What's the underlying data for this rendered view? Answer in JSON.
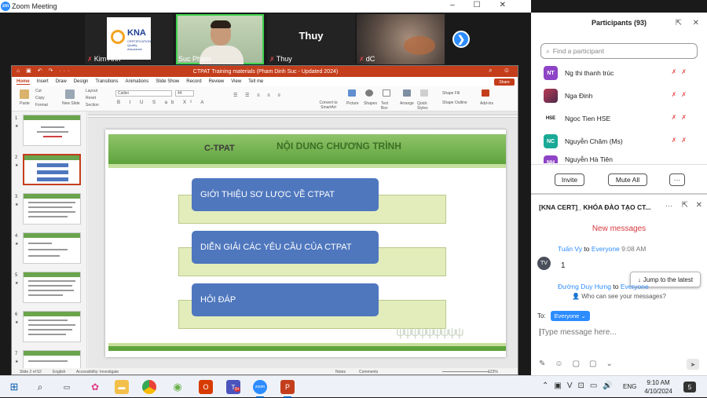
{
  "zoom": {
    "title": "Zoom Meeting",
    "logo_text": "zm",
    "tiles": [
      {
        "name": "Kim Anh",
        "logo": "KNA",
        "logo_sub": "CERTIFICATION Quality Assurance"
      },
      {
        "name": "Suc Pham"
      },
      {
        "name": "Thuy",
        "center": "Thuy"
      },
      {
        "name": "dC"
      }
    ]
  },
  "ppt": {
    "title": "CTPAT Training materials (Pham Dinh Suc - Updated 2024)",
    "tabs": [
      "Home",
      "Insert",
      "Draw",
      "Design",
      "Transitions",
      "Animations",
      "Slide Show",
      "Record",
      "Review",
      "View",
      "Tell me"
    ],
    "share": "Share",
    "ribbon": {
      "paste": "Paste",
      "cut": "Cut",
      "copy": "Copy",
      "format": "Format",
      "new_slide": "New Slide",
      "layout": "Layout",
      "reset": "Reset",
      "section": "Section",
      "font": "Calibri",
      "size": "44",
      "convert": "Convert to SmartArt",
      "picture": "Picture",
      "shapes": "Shapes",
      "textbox": "Text Box",
      "arrange": "Arrange",
      "quick_styles": "Quick Styles",
      "shape_fill": "Shape Fill",
      "shape_outline": "Shape Outline",
      "addins": "Add-ins"
    },
    "thumb_numbers": [
      "1",
      "2",
      "3",
      "4",
      "5",
      "6",
      "7"
    ],
    "slide": {
      "ctpat": "C-TPAT",
      "heading": "NỘI DUNG CHƯƠNG TRÌNH",
      "items": [
        "GIỚI THIỆU SƠ LƯỢC VỀ CTPAT",
        "DIỄN GIẢI CÁC YÊU CẦU CỦA CTPAT",
        "HỎI ĐÁP"
      ]
    },
    "status": {
      "slide": "Slide 2 of 62",
      "lang": "English",
      "accessibility": "Accessibility: Investigate",
      "notes": "Notes",
      "comments": "Comments",
      "zoom": "123%"
    }
  },
  "participants": {
    "title": "Participants (93)",
    "search_placeholder": "Find a participant",
    "list": [
      {
        "initials": "NT",
        "name": "Ng thi thanh trúc",
        "color": "#8e44c6"
      },
      {
        "initials": "",
        "name": "Nga Đinh",
        "color": "#b83b56"
      },
      {
        "initials": "HSE",
        "name": "Ngoc Tien HSE",
        "color": "#ffffff"
      },
      {
        "initials": "NC",
        "name": "Nguyễn Châm (Ms)",
        "color": "#19a996"
      },
      {
        "initials": "NH",
        "name": "Nguyễn Hà Tiên",
        "color": "#8e44c6"
      }
    ],
    "invite": "Invite",
    "mute_all": "Mute All",
    "more": "···"
  },
  "chat": {
    "title": "[KNA CERT]_ KHÓA ĐÀO TẠO CT...",
    "new_messages": "New messages",
    "msg1": {
      "avatar": "TV",
      "sender": "Tuấn Vy",
      "to": "to",
      "target": "Everyone",
      "time": "9:08 AM",
      "text": "1"
    },
    "jump": "Jump to the latest",
    "sender2": "Đường Duy Hưng",
    "to2": "to",
    "target2": "Everyone",
    "who_can_see": "Who can see your messages?",
    "to_label": "To:",
    "recipient": "Everyone",
    "input_placeholder": "Type message here..."
  },
  "taskbar": {
    "lang": "ENG",
    "time": "9:10 AM",
    "date": "4/10/2024",
    "notif": "5",
    "teams_badge": "9+"
  }
}
